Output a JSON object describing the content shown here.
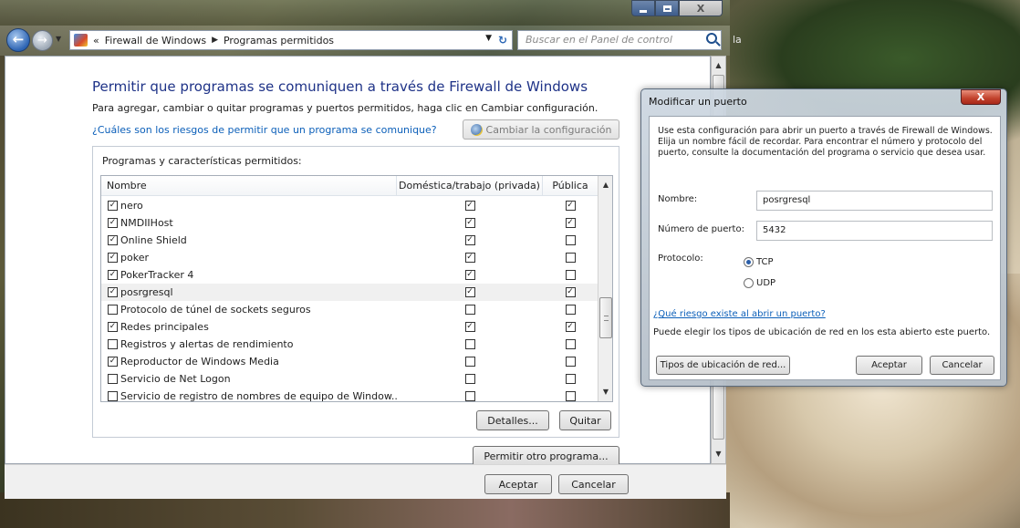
{
  "window": {
    "minimize": "",
    "maximize": "",
    "close": "X"
  },
  "address": {
    "crumb_prefix": "«",
    "crumbs": [
      "Firewall de Windows",
      "Programas permitidos"
    ],
    "search_placeholder": "Buscar en el Panel de control",
    "trailing_text": "la"
  },
  "main": {
    "heading": "Permitir que programas se comuniquen a través de Firewall de Windows",
    "subtext": "Para agregar, cambiar o quitar programas y puertos permitidos, haga clic en Cambiar configuración.",
    "risk_link": "¿Cuáles son los riesgos de permitir que un programa se comunique?",
    "change_settings": "Cambiar la configuración",
    "group_label": "Programas y características permitidos:",
    "columns": {
      "name": "Nombre",
      "domestic": "Doméstica/trabajo (privada)",
      "public": "Pública"
    },
    "rows": [
      {
        "name": "nero",
        "enabled": true,
        "private": true,
        "public": true
      },
      {
        "name": "NMDIIHost",
        "enabled": true,
        "private": true,
        "public": true
      },
      {
        "name": "Online Shield",
        "enabled": true,
        "private": true,
        "public": false
      },
      {
        "name": "poker",
        "enabled": true,
        "private": true,
        "public": false
      },
      {
        "name": "PokerTracker 4",
        "enabled": true,
        "private": true,
        "public": false
      },
      {
        "name": "posrgresql",
        "enabled": true,
        "private": true,
        "public": true,
        "selected": true
      },
      {
        "name": "Protocolo de túnel de sockets seguros",
        "enabled": false,
        "private": false,
        "public": false
      },
      {
        "name": "Redes principales",
        "enabled": true,
        "private": true,
        "public": true
      },
      {
        "name": "Registros y alertas de rendimiento",
        "enabled": false,
        "private": false,
        "public": false
      },
      {
        "name": "Reproductor de Windows Media",
        "enabled": true,
        "private": false,
        "public": false
      },
      {
        "name": "Servicio de Net Logon",
        "enabled": false,
        "private": false,
        "public": false
      },
      {
        "name": "Servicio de registro de nombres de equipo de Window...",
        "enabled": false,
        "private": false,
        "public": false
      }
    ],
    "details_button": "Detalles...",
    "remove_button": "Quitar",
    "allow_other_button": "Permitir otro programa...",
    "ok_button": "Aceptar",
    "cancel_button": "Cancelar"
  },
  "dialog": {
    "title": "Modificar un puerto",
    "close": "X",
    "description": "Use esta configuración para abrir un puerto a través de Firewall de Windows. Elija un nombre fácil de recordar. Para encontrar el número y protocolo del puerto, consulte la documentación del programa o servicio que desea usar.",
    "name_label": "Nombre:",
    "name_value": "posrgresql",
    "port_label": "Número de puerto:",
    "port_value": "5432",
    "protocol_label": "Protocolo:",
    "protocol_tcp": "TCP",
    "protocol_udp": "UDP",
    "protocol_selected": "TCP",
    "risk_link": "¿Qué riesgo existe al abrir un puerto?",
    "note": "Puede elegir los tipos de ubicación de red en los esta abierto este puerto.",
    "network_button": "Tipos de ubicación de red...",
    "ok_button": "Aceptar",
    "cancel_button": "Cancelar"
  },
  "colors": {
    "heading": "#1e3287",
    "link": "#0b5fb9",
    "close_red": "#c1412b"
  }
}
